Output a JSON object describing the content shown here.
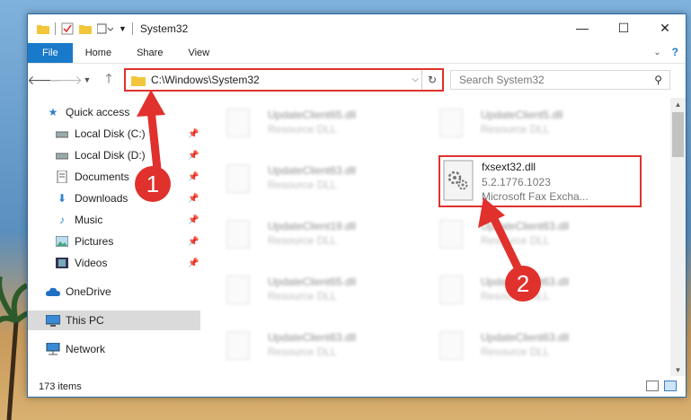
{
  "window": {
    "title": "System32",
    "controls": {
      "minimize": "—",
      "maximize": "☐",
      "close": "✕"
    }
  },
  "ribbon": {
    "tabs": [
      "File",
      "Home",
      "Share",
      "View"
    ],
    "help_symbol": "?"
  },
  "nav": {
    "address": "C:\\Windows\\System32",
    "search_placeholder": "Search System32"
  },
  "sidebar": {
    "items": [
      {
        "label": "Quick access",
        "icon": "star-icon",
        "pinned": false
      },
      {
        "label": "Local Disk (C:)",
        "icon": "drive-icon",
        "pinned": true
      },
      {
        "label": "Local Disk (D:)",
        "icon": "drive-icon",
        "pinned": true
      },
      {
        "label": "Documents",
        "icon": "documents-icon",
        "pinned": true
      },
      {
        "label": "Downloads",
        "icon": "download-icon",
        "pinned": true
      },
      {
        "label": "Music",
        "icon": "music-icon",
        "pinned": true
      },
      {
        "label": "Pictures",
        "icon": "pictures-icon",
        "pinned": true
      },
      {
        "label": "Videos",
        "icon": "videos-icon",
        "pinned": true
      },
      {
        "label": "OneDrive",
        "icon": "cloud-icon",
        "pinned": false
      },
      {
        "label": "This PC",
        "icon": "computer-icon",
        "pinned": false
      },
      {
        "label": "Network",
        "icon": "network-icon",
        "pinned": false
      }
    ]
  },
  "files": {
    "left_column": [
      {
        "name": "UpdateClient65.dll",
        "desc": "Resource DLL"
      },
      {
        "name": "UpdateClient63.dll",
        "desc": "Resource DLL"
      },
      {
        "name": "UpdateClient19.dll",
        "desc": "Resource DLL"
      },
      {
        "name": "UpdateClient65.dll",
        "desc": "Resource DLL"
      },
      {
        "name": "UpdateClient63.dll",
        "desc": "Resource DLL"
      }
    ],
    "right_column": [
      {
        "name": "UpdateClient5.dll",
        "desc": "Resource DLL"
      },
      {
        "name": "UpdateClient63.dll",
        "desc": "Resource DLL"
      },
      {
        "name": "UpdateClient63.dll",
        "desc": "Resource DLL"
      },
      {
        "name": "UpdateClient63.dll",
        "desc": "Resource DLL"
      }
    ],
    "highlighted": {
      "name": "fxsext32.dll",
      "version": "5.2.1776.1023",
      "desc": "Microsoft Fax Excha..."
    }
  },
  "status": {
    "item_count": "173 items"
  },
  "annotations": {
    "step1": "1",
    "step2": "2",
    "color": "#e0312d"
  }
}
